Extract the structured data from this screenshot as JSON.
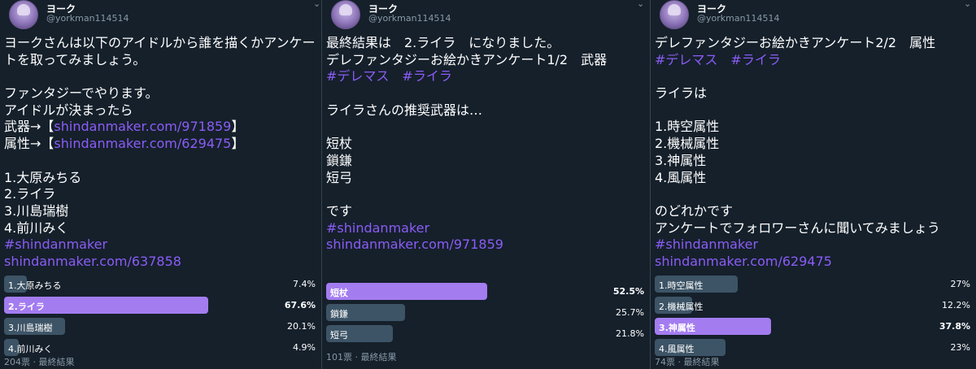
{
  "account": {
    "name": "ヨーク",
    "handle": "@yorkman114514"
  },
  "tweets": [
    {
      "lines": [
        {
          "t": "ヨークさんは以下のアイドルから誰を描くかアンケー",
          "link": false
        },
        {
          "t": "トを取ってみましょう。",
          "link": false
        },
        {
          "t": "",
          "link": false
        },
        {
          "t": "ファンタジーでやります。",
          "link": false
        },
        {
          "t": "アイドルが決まったら",
          "link": false
        },
        {
          "t": "武器→【",
          "link": false,
          "parts": [
            {
              "t": "武器→【",
              "link": false
            },
            {
              "t": "shindanmaker.com/971859",
              "link": true
            },
            {
              "t": "】",
              "link": false
            }
          ]
        },
        {
          "t": "属性→【",
          "link": false,
          "parts": [
            {
              "t": "属性→【",
              "link": false
            },
            {
              "t": "shindanmaker.com/629475",
              "link": true
            },
            {
              "t": "】",
              "link": false
            }
          ]
        },
        {
          "t": "",
          "link": false
        },
        {
          "t": "1.大原みちる",
          "link": false
        },
        {
          "t": "2.ライラ",
          "link": false
        },
        {
          "t": "3.川島瑞樹",
          "link": false
        },
        {
          "t": "4.前川みく",
          "link": false
        },
        {
          "t": "#shindanmaker",
          "link": true
        },
        {
          "t": "shindanmaker.com/637858",
          "link": true
        }
      ],
      "poll": [
        {
          "label": "1.大原みちる",
          "percent": "7.4%",
          "value": 7.4,
          "winner": false
        },
        {
          "label": "2.ライラ",
          "percent": "67.6%",
          "value": 67.6,
          "winner": true
        },
        {
          "label": "3.川島瑞樹",
          "percent": "20.1%",
          "value": 20.1,
          "winner": false
        },
        {
          "label": "4.前川みく",
          "percent": "4.9%",
          "value": 4.9,
          "winner": false
        }
      ],
      "footer": "204票 · 最終結果"
    },
    {
      "lines": [
        {
          "t": "最終結果は　2.ライラ　になりました。",
          "link": false
        },
        {
          "t": "デレファンタジーお絵かきアンケート1/2　武器",
          "link": false
        },
        {
          "t": "#デレマス　#ライラ",
          "link": true
        },
        {
          "t": "",
          "link": false
        },
        {
          "t": "ライラさんの推奨武器は…",
          "link": false
        },
        {
          "t": "",
          "link": false
        },
        {
          "t": "短杖",
          "link": false
        },
        {
          "t": "鎖鎌",
          "link": false
        },
        {
          "t": "短弓",
          "link": false
        },
        {
          "t": "",
          "link": false
        },
        {
          "t": "です",
          "link": false
        },
        {
          "t": "#shindanmaker",
          "link": true
        },
        {
          "t": "shindanmaker.com/971859",
          "link": true
        }
      ],
      "poll": [
        {
          "label": "短杖",
          "percent": "52.5%",
          "value": 52.5,
          "winner": true
        },
        {
          "label": "鎖鎌",
          "percent": "25.7%",
          "value": 25.7,
          "winner": false
        },
        {
          "label": "短弓",
          "percent": "21.8%",
          "value": 21.8,
          "winner": false
        }
      ],
      "footer": "101票 · 最終結果"
    },
    {
      "lines": [
        {
          "t": "デレファンタジーお絵かきアンケート2/2　属性",
          "link": false
        },
        {
          "t": "#デレマス　#ライラ",
          "link": true
        },
        {
          "t": "",
          "link": false
        },
        {
          "t": "ライラは",
          "link": false
        },
        {
          "t": "",
          "link": false
        },
        {
          "t": "1.時空属性",
          "link": false
        },
        {
          "t": "2.機械属性",
          "link": false
        },
        {
          "t": "3.神属性",
          "link": false
        },
        {
          "t": "4.風属性",
          "link": false
        },
        {
          "t": "",
          "link": false
        },
        {
          "t": "のどれかです",
          "link": false
        },
        {
          "t": "アンケートでフォロワーさんに聞いてみましょう",
          "link": false
        },
        {
          "t": "#shindanmaker",
          "link": true
        },
        {
          "t": "shindanmaker.com/629475",
          "link": true
        }
      ],
      "poll": [
        {
          "label": "1.時空属性",
          "percent": "27%",
          "value": 27,
          "winner": false
        },
        {
          "label": "2.機械属性",
          "percent": "12.2%",
          "value": 12.2,
          "winner": false
        },
        {
          "label": "3.神属性",
          "percent": "37.8%",
          "value": 37.8,
          "winner": true
        },
        {
          "label": "4.風属性",
          "percent": "23%",
          "value": 23,
          "winner": false
        }
      ],
      "footer": "74票 · 最終結果"
    }
  ],
  "colors": {
    "background": "#15202b",
    "link": "#8b5cf6",
    "poll_winner": "#a37cf0",
    "poll_bar": "#3d5466",
    "muted": "#8899a6"
  },
  "icons": {
    "menu": "chevron-down-icon",
    "avatar": "avatar"
  }
}
